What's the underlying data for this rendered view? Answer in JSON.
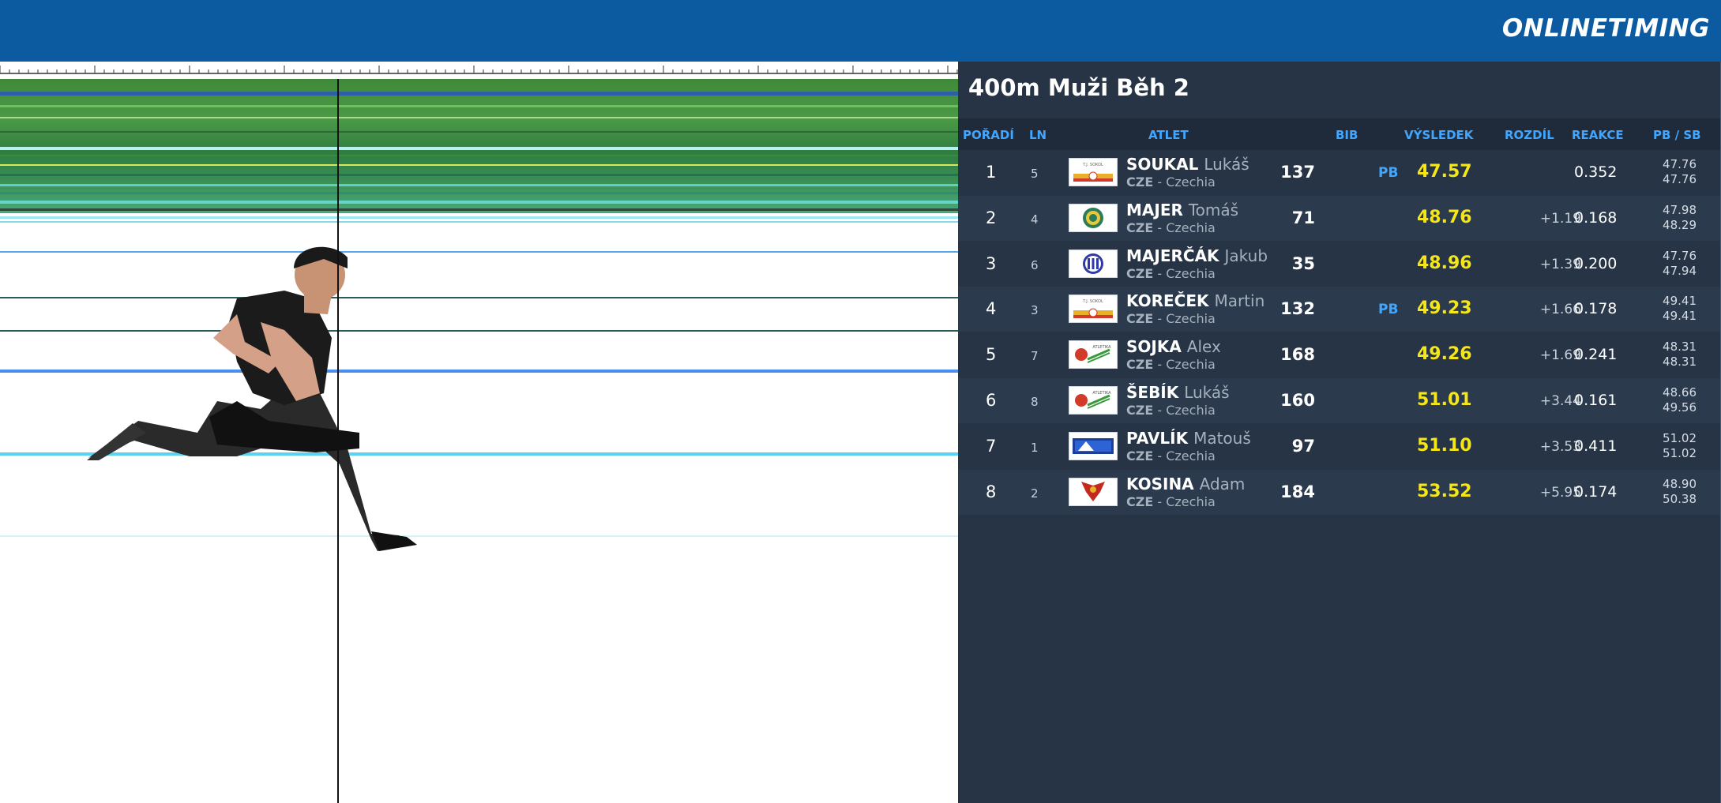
{
  "brand": {
    "logo_text": "ONLINETIMING",
    "topbar_color": "#0c5aa0"
  },
  "photo_finish": {
    "description_icon": "photo-finish-image"
  },
  "event": {
    "title": "400m Muži Běh 2"
  },
  "table": {
    "headers": {
      "rank": "POŘADÍ",
      "lane": "LN",
      "athlete": "ATLET",
      "bib": "BIB",
      "result": "VÝSLEDEK",
      "diff": "ROZDÍL",
      "reaction": "REAKCE",
      "pbsb": "PB / SB"
    },
    "rows": [
      {
        "rank": "1",
        "lane": "5",
        "surname": "SOUKAL",
        "firstname": "Lukáš",
        "country_code": "CZE",
        "country_name": " - Czechia",
        "bib": "137",
        "pb_flag": "PB",
        "result": "47.57",
        "diff": "",
        "reaction": "0.352",
        "pb": "47.76",
        "sb": "47.76",
        "club_icon": "sokol-hradec-kralove-logo"
      },
      {
        "rank": "2",
        "lane": "4",
        "surname": "MAJER",
        "firstname": "Tomáš",
        "country_code": "CZE",
        "country_name": " - Czechia",
        "bib": "71",
        "pb_flag": "",
        "result": "48.76",
        "diff": "+1.19",
        "reaction": "0.168",
        "pb": "47.98",
        "sb": "48.29",
        "club_icon": "round-green-club-logo"
      },
      {
        "rank": "3",
        "lane": "6",
        "surname": "MAJERČÁK",
        "firstname": "Jakub",
        "country_code": "CZE",
        "country_name": " - Czechia",
        "bib": "35",
        "pb_flag": "",
        "result": "48.96",
        "diff": "+1.39",
        "reaction": "0.200",
        "pb": "47.76",
        "sb": "47.94",
        "club_icon": "round-blue-club-logo"
      },
      {
        "rank": "4",
        "lane": "3",
        "surname": "KOREČEK",
        "firstname": "Martin",
        "country_code": "CZE",
        "country_name": " - Czechia",
        "bib": "132",
        "pb_flag": "PB",
        "result": "49.23",
        "diff": "+1.66",
        "reaction": "0.178",
        "pb": "49.41",
        "sb": "49.41",
        "club_icon": "sokol-hradec-kralove-logo"
      },
      {
        "rank": "5",
        "lane": "7",
        "surname": "SOJKA",
        "firstname": "Alex",
        "country_code": "CZE",
        "country_name": " - Czechia",
        "bib": "168",
        "pb_flag": "",
        "result": "49.26",
        "diff": "+1.69",
        "reaction": "0.241",
        "pb": "48.31",
        "sb": "48.31",
        "club_icon": "atletika-club-logo"
      },
      {
        "rank": "6",
        "lane": "8",
        "surname": "ŠEBÍK",
        "firstname": "Lukáš",
        "country_code": "CZE",
        "country_name": " - Czechia",
        "bib": "160",
        "pb_flag": "",
        "result": "51.01",
        "diff": "+3.44",
        "reaction": "0.161",
        "pb": "48.66",
        "sb": "49.56",
        "club_icon": "atletika-club-logo"
      },
      {
        "rank": "7",
        "lane": "1",
        "surname": "PAVLÍK",
        "firstname": "Matouš",
        "country_code": "CZE",
        "country_name": " - Czechia",
        "bib": "97",
        "pb_flag": "",
        "result": "51.10",
        "diff": "+3.53",
        "reaction": "0.411",
        "pb": "51.02",
        "sb": "51.02",
        "club_icon": "blue-banner-club-logo"
      },
      {
        "rank": "8",
        "lane": "2",
        "surname": "KOSINA",
        "firstname": "Adam",
        "country_code": "CZE",
        "country_name": " - Czechia",
        "bib": "184",
        "pb_flag": "",
        "result": "53.52",
        "diff": "+5.95",
        "reaction": "0.174",
        "pb": "48.90",
        "sb": "50.38",
        "club_icon": "eagle-club-logo"
      }
    ]
  },
  "colors": {
    "panel_bg": "#263445",
    "header_text": "#41a6ff",
    "result_text": "#f5e61a"
  }
}
